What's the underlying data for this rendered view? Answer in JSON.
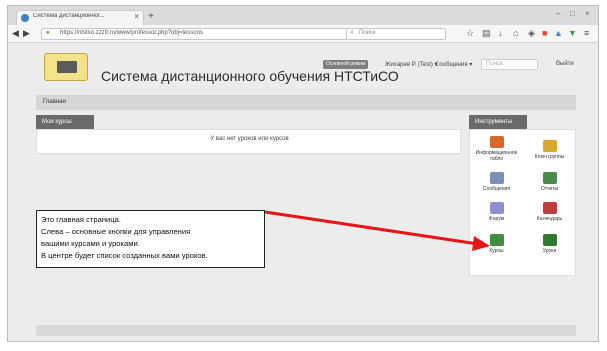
{
  "browser": {
    "tab_title": "Система дистанционног...",
    "tab_close": "×",
    "new_tab": "+",
    "url": "https://ntstso.zzz9.ru/www/professor.php?obj=lessons",
    "search_placeholder": "Поиск",
    "window_minimize": "–",
    "window_maximize": "□",
    "window_close": "×"
  },
  "site": {
    "title": "Система дистанционного обучения НТСТиСО",
    "mode_badge": "Основной режим",
    "user_menu": "Жихарев Р. (Test) ▾",
    "messages_menu": "Сообщения ▾",
    "search_placeholder": "Поиск",
    "logout": "Выйти"
  },
  "breadcrumb": "Главная",
  "courses_panel": {
    "tab_label": "Мои курсы",
    "empty_text": "У вас нет уроков или курсов"
  },
  "tools_panel": {
    "tab_label": "Инструменты",
    "items": [
      {
        "label": "Информационное табло",
        "icon": "person-icon",
        "color": "#d9662b"
      },
      {
        "label": "Ключ группы",
        "icon": "key-icon",
        "color": "#d9a72b"
      },
      {
        "label": "Сообщения",
        "icon": "envelope-icon",
        "color": "#7b8fb8"
      },
      {
        "label": "Отчеты",
        "icon": "report-icon",
        "color": "#4b8a4b"
      },
      {
        "label": "Форум",
        "icon": "forum-icon",
        "color": "#8f8fd0"
      },
      {
        "label": "Календарь",
        "icon": "calendar-icon",
        "color": "#c23b3b"
      },
      {
        "label": "Курсы",
        "icon": "courses-icon",
        "color": "#3f8f3f"
      },
      {
        "label": "Уроки",
        "icon": "lessons-icon",
        "color": "#2f7a2f"
      }
    ]
  },
  "annotation": {
    "lines": [
      "Это главная страница.",
      "Слева – основные кнопки для управления",
      "вашими курсами и уроками.",
      "В центре будет список созданных вами уроков."
    ],
    "arrow_color": "#e8141a"
  }
}
